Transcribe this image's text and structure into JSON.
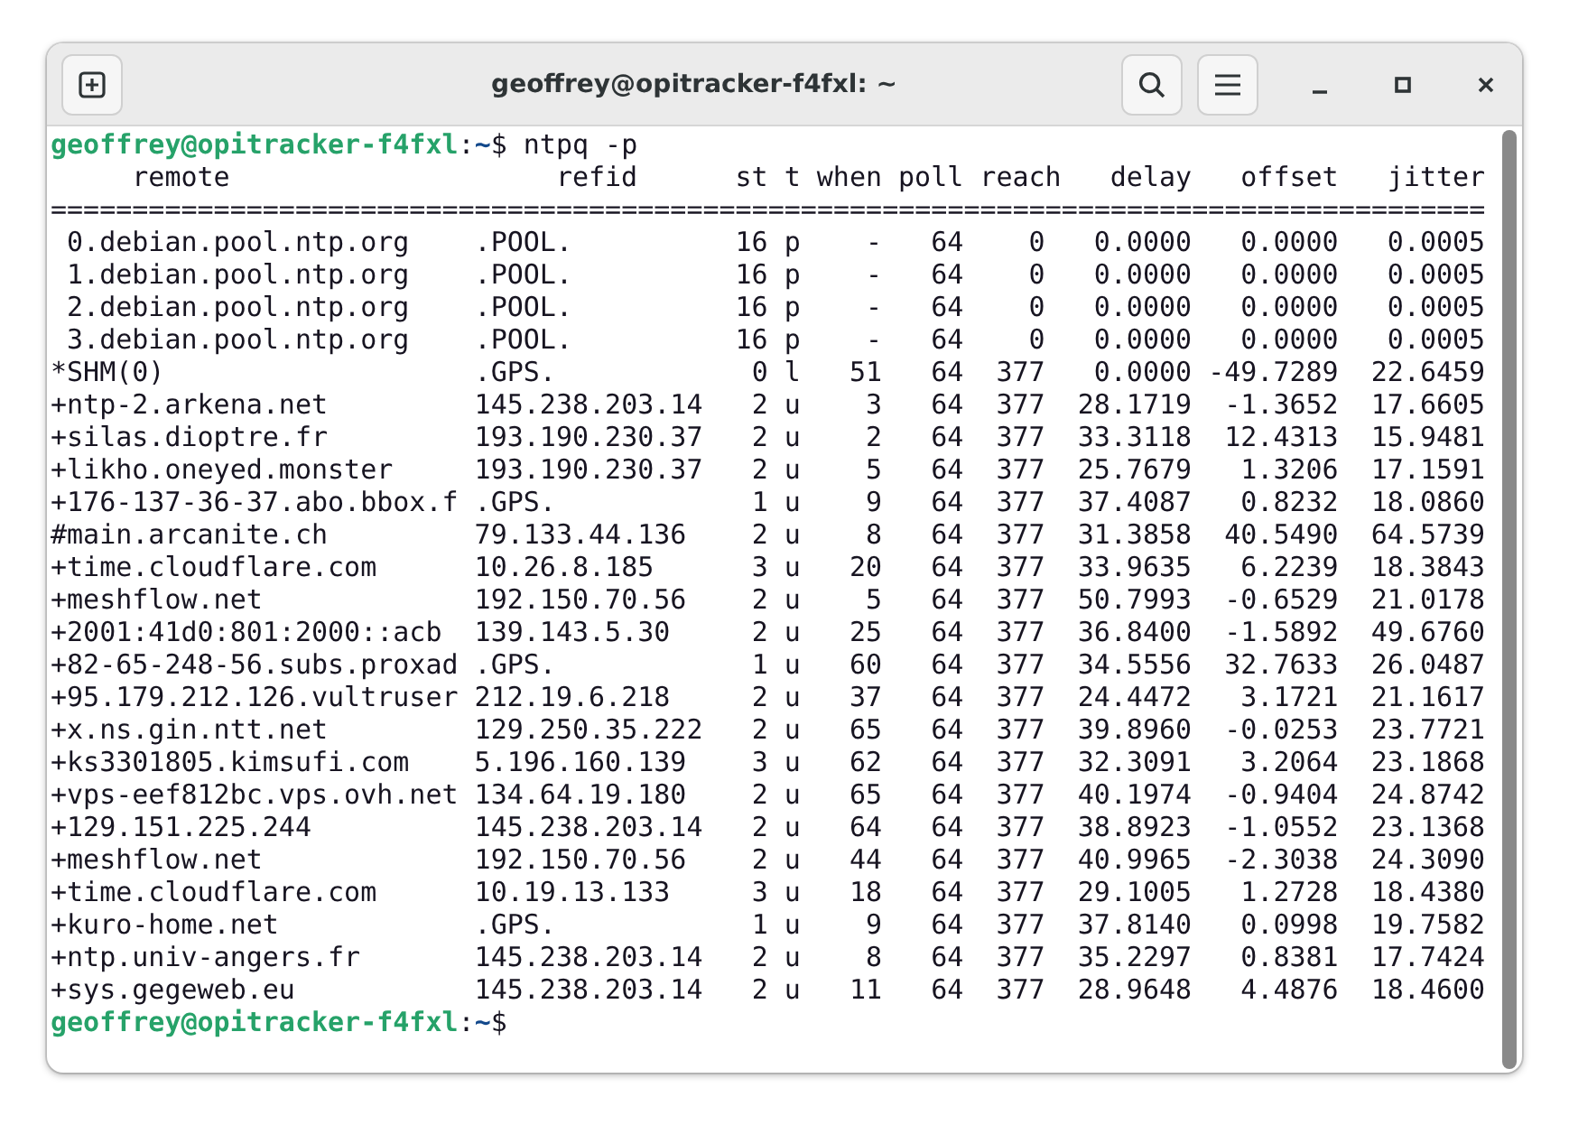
{
  "window": {
    "title": "geoffrey@opitracker-f4fxl: ~"
  },
  "terminal": {
    "command_prompt": {
      "user_host": "geoffrey@opitracker-f4fxl",
      "separator": ":",
      "path": "~",
      "symbol": "$",
      "command": "ntpq -p"
    },
    "table": {
      "columns": [
        "remote",
        "refid",
        "st",
        "t",
        "when",
        "poll",
        "reach",
        "delay",
        "offset",
        "jitter"
      ],
      "rule": "========================================================================================",
      "rows": [
        {
          "cells": [
            "0.debian.pool.ntp.org",
            ".POOL.",
            "16",
            "p",
            "-",
            "64",
            "0",
            "0.0000",
            "0.0000",
            "0.0005"
          ]
        },
        {
          "cells": [
            "1.debian.pool.ntp.org",
            ".POOL.",
            "16",
            "p",
            "-",
            "64",
            "0",
            "0.0000",
            "0.0000",
            "0.0005"
          ]
        },
        {
          "cells": [
            "2.debian.pool.ntp.org",
            ".POOL.",
            "16",
            "p",
            "-",
            "64",
            "0",
            "0.0000",
            "0.0000",
            "0.0005"
          ]
        },
        {
          "cells": [
            "3.debian.pool.ntp.org",
            ".POOL.",
            "16",
            "p",
            "-",
            "64",
            "0",
            "0.0000",
            "0.0000",
            "0.0005"
          ]
        },
        {
          "tally": "*",
          "cells": [
            "SHM(0)",
            ".GPS.",
            "0",
            "l",
            "51",
            "64",
            "377",
            "0.0000",
            "-49.7289",
            "22.6459"
          ]
        },
        {
          "tally": "+",
          "cells": [
            "ntp-2.arkena.net",
            "145.238.203.14",
            "2",
            "u",
            "3",
            "64",
            "377",
            "28.1719",
            "-1.3652",
            "17.6605"
          ]
        },
        {
          "tally": "+",
          "cells": [
            "silas.dioptre.fr",
            "193.190.230.37",
            "2",
            "u",
            "2",
            "64",
            "377",
            "33.3118",
            "12.4313",
            "15.9481"
          ]
        },
        {
          "tally": "+",
          "cells": [
            "likho.oneyed.monster",
            "193.190.230.37",
            "2",
            "u",
            "5",
            "64",
            "377",
            "25.7679",
            "1.3206",
            "17.1591"
          ]
        },
        {
          "tally": "+",
          "cells": [
            "176-137-36-37.abo.bbox.f",
            ".GPS.",
            "1",
            "u",
            "9",
            "64",
            "377",
            "37.4087",
            "0.8232",
            "18.0860"
          ]
        },
        {
          "tally": "#",
          "cells": [
            "main.arcanite.ch",
            "79.133.44.136",
            "2",
            "u",
            "8",
            "64",
            "377",
            "31.3858",
            "40.5490",
            "64.5739"
          ]
        },
        {
          "tally": "+",
          "cells": [
            "time.cloudflare.com",
            "10.26.8.185",
            "3",
            "u",
            "20",
            "64",
            "377",
            "33.9635",
            "6.2239",
            "18.3843"
          ]
        },
        {
          "tally": "+",
          "cells": [
            "meshflow.net",
            "192.150.70.56",
            "2",
            "u",
            "5",
            "64",
            "377",
            "50.7993",
            "-0.6529",
            "21.0178"
          ]
        },
        {
          "tally": "+",
          "cells": [
            "2001:41d0:801:2000::acb",
            "139.143.5.30",
            "2",
            "u",
            "25",
            "64",
            "377",
            "36.8400",
            "-1.5892",
            "49.6760"
          ]
        },
        {
          "tally": "+",
          "cells": [
            "82-65-248-56.subs.proxad",
            ".GPS.",
            "1",
            "u",
            "60",
            "64",
            "377",
            "34.5556",
            "32.7633",
            "26.0487"
          ]
        },
        {
          "tally": "+",
          "cells": [
            "95.179.212.126.vultruser",
            "212.19.6.218",
            "2",
            "u",
            "37",
            "64",
            "377",
            "24.4472",
            "3.1721",
            "21.1617"
          ]
        },
        {
          "tally": "+",
          "cells": [
            "x.ns.gin.ntt.net",
            "129.250.35.222",
            "2",
            "u",
            "65",
            "64",
            "377",
            "39.8960",
            "-0.0253",
            "23.7721"
          ]
        },
        {
          "tally": "+",
          "cells": [
            "ks3301805.kimsufi.com",
            "5.196.160.139",
            "3",
            "u",
            "62",
            "64",
            "377",
            "32.3091",
            "3.2064",
            "23.1868"
          ]
        },
        {
          "tally": "+",
          "cells": [
            "vps-eef812bc.vps.ovh.net",
            "134.64.19.180",
            "2",
            "u",
            "65",
            "64",
            "377",
            "40.1974",
            "-0.9404",
            "24.8742"
          ]
        },
        {
          "tally": "+",
          "cells": [
            "129.151.225.244",
            "145.238.203.14",
            "2",
            "u",
            "64",
            "64",
            "377",
            "38.8923",
            "-1.0552",
            "23.1368"
          ]
        },
        {
          "tally": "+",
          "cells": [
            "meshflow.net",
            "192.150.70.56",
            "2",
            "u",
            "44",
            "64",
            "377",
            "40.9965",
            "-2.3038",
            "24.3090"
          ]
        },
        {
          "tally": "+",
          "cells": [
            "time.cloudflare.com",
            "10.19.13.133",
            "3",
            "u",
            "18",
            "64",
            "377",
            "29.1005",
            "1.2728",
            "18.4380"
          ]
        },
        {
          "tally": "+",
          "cells": [
            "kuro-home.net",
            ".GPS.",
            "1",
            "u",
            "9",
            "64",
            "377",
            "37.8140",
            "0.0998",
            "19.7582"
          ]
        },
        {
          "tally": "+",
          "cells": [
            "ntp.univ-angers.fr",
            "145.238.203.14",
            "2",
            "u",
            "8",
            "64",
            "377",
            "35.2297",
            "0.8381",
            "17.7424"
          ]
        },
        {
          "tally": "+",
          "cells": [
            "sys.gegeweb.eu",
            "145.238.203.14",
            "2",
            "u",
            "11",
            "64",
            "377",
            "28.9648",
            "4.4876",
            "18.4600"
          ]
        }
      ]
    },
    "final_prompt": {
      "user_host": "geoffrey@opitracker-f4fxl",
      "separator": ":",
      "path": "~",
      "symbol": "$"
    }
  }
}
